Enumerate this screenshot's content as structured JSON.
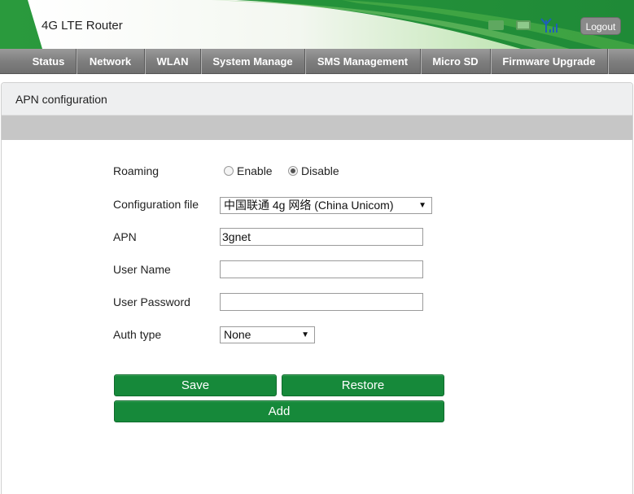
{
  "header": {
    "brand": "4G LTE Router",
    "logout_label": "Logout",
    "icons": [
      "sim-icon",
      "battery-icon",
      "signal-icon"
    ]
  },
  "nav": {
    "items": [
      {
        "label": "Status"
      },
      {
        "label": "Network"
      },
      {
        "label": "WLAN"
      },
      {
        "label": "System Manage"
      },
      {
        "label": "SMS Management"
      },
      {
        "label": "Micro SD"
      },
      {
        "label": "Firmware Upgrade"
      }
    ]
  },
  "panel": {
    "title": "APN configuration"
  },
  "form": {
    "roaming": {
      "label": "Roaming",
      "options": [
        "Enable",
        "Disable"
      ],
      "selected": "Disable"
    },
    "config_file": {
      "label": "Configuration file",
      "value": "中国联通 4g 网络 (China Unicom)"
    },
    "apn": {
      "label": "APN",
      "value": "3gnet"
    },
    "user_name": {
      "label": "User Name",
      "value": ""
    },
    "user_password": {
      "label": "User Password",
      "value": ""
    },
    "auth_type": {
      "label": "Auth type",
      "value": "None"
    }
  },
  "buttons": {
    "save": "Save",
    "restore": "Restore",
    "add": "Add"
  },
  "colors": {
    "brand_green": "#2e9a3e",
    "button_green": "#16893a",
    "nav_gray": "#7f7f7f"
  }
}
